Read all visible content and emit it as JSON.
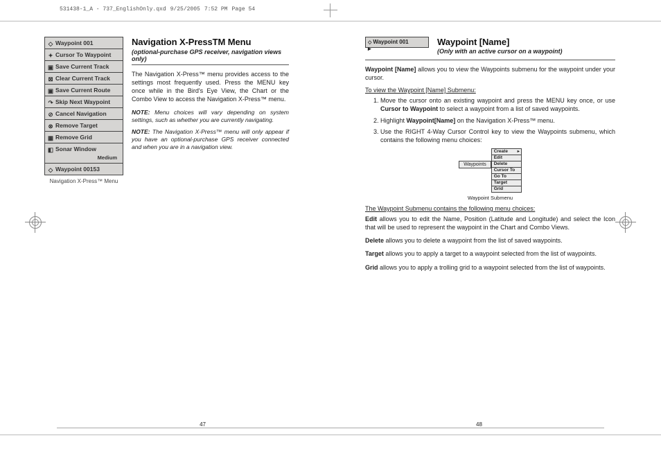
{
  "header": {
    "filename": "531438-1_A - 737_EnglishOnly.qxd",
    "date": "9/25/2005",
    "time": "7:52 PM",
    "page": "Page 54"
  },
  "left": {
    "menu_items": [
      {
        "glyph": "◇",
        "label": "Waypoint 001"
      },
      {
        "glyph": "✦",
        "label": "Cursor To Waypoint"
      },
      {
        "glyph": "▣",
        "label": "Save Current Track"
      },
      {
        "glyph": "⊠",
        "label": "Clear Current Track"
      },
      {
        "glyph": "▣",
        "label": "Save Current Route"
      },
      {
        "glyph": "↷",
        "label": "Skip Next Waypoint"
      },
      {
        "glyph": "⊘",
        "label": "Cancel Navigation"
      },
      {
        "glyph": "⊗",
        "label": "Remove Target"
      },
      {
        "glyph": "▦",
        "label": "Remove Grid"
      },
      {
        "glyph": "◧",
        "label": "Sonar Window",
        "sub": "Medium"
      },
      {
        "glyph": "◇",
        "label": "Waypoint 00153"
      }
    ],
    "menu_caption": "Navigation X-Press™ Menu",
    "title": "Navigation X-PressTM Menu",
    "subhead": "(optional-purchase GPS receiver, navigation views only)",
    "body": "The Navigation X-Press™ menu provides access to the settings most frequently used.  Press the MENU key once while in the Bird's Eye View, the Chart or the Combo View to access the Navigation X-Press™ menu.",
    "note1_label": "NOTE:",
    "note1": " Menu choices will vary depending on system settings, such as whether you are currently navigating.",
    "note2_label": "NOTE:",
    "note2": " The Navigation X-Press™ menu will only appear if you have an optional-purchase GPS receiver connected and when you are in a navigation view.",
    "page_num": "47"
  },
  "right": {
    "chip": "Waypoint 001",
    "title": "Waypoint [Name]",
    "subhead": "(Only with an active cursor on a waypoint)",
    "intro": "Waypoint [Name] allows you to view the Waypoints submenu for the waypoint under your cursor.",
    "intro_bold": "Waypoint [Name]",
    "howto": "To view the Waypoint [Name] Submenu:",
    "steps": [
      {
        "pre": "Move the cursor onto an existing waypoint and press the MENU key once, or use ",
        "b": "Cursor to Waypoint",
        "post": " to select a waypoint from a list of saved waypoints."
      },
      {
        "pre": "Highlight ",
        "b": "Waypoint[Name]",
        "post": " on the Navigation X-Press™ menu."
      },
      {
        "pre": "Use the RIGHT 4-Way Cursor Control key to view the Waypoints submenu, which contains the following menu choices:",
        "b": "",
        "post": ""
      }
    ],
    "submenu_label": "Waypoints",
    "submenu_items": [
      "Create",
      "Edit",
      "Delete",
      "Cursor To",
      "Go To",
      "Target",
      "Grid"
    ],
    "submenu_caption": "Waypoint Submenu",
    "choices_head": "The Waypoint Submenu contains the following menu choices:",
    "choices": [
      {
        "b": "Edit",
        "t": " allows you to edit the Name, Position (Latitude and Longitude) and select the Icon that will be used to represent the waypoint in the Chart and Combo Views."
      },
      {
        "b": "Delete",
        "t": " allows you to delete a waypoint from the list of saved waypoints."
      },
      {
        "b": "Target",
        "t": " allows you to apply a target to a waypoint selected from the list of waypoints."
      },
      {
        "b": "Grid",
        "t": " allows you to apply a trolling grid to a waypoint selected from the list of waypoints."
      }
    ],
    "page_num": "48"
  }
}
